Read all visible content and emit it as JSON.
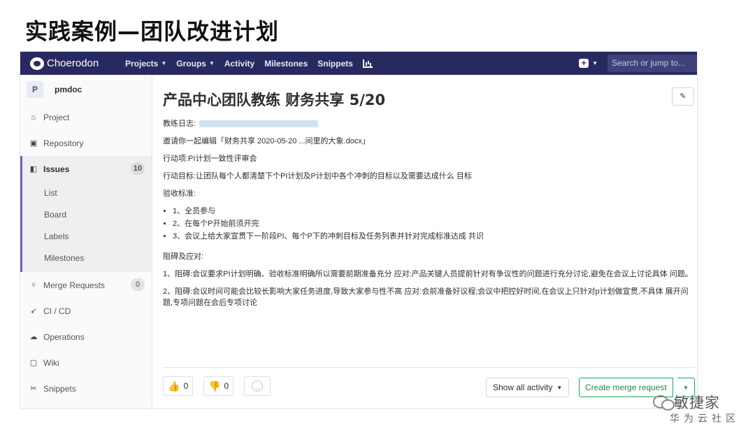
{
  "slide": {
    "title": "实践案例—团队改进计划"
  },
  "navbar": {
    "brand": "Choerodon",
    "items": [
      {
        "label": "Projects",
        "dropdown": true
      },
      {
        "label": "Groups",
        "dropdown": true
      },
      {
        "label": "Activity",
        "dropdown": false
      },
      {
        "label": "Milestones",
        "dropdown": false
      },
      {
        "label": "Snippets",
        "dropdown": false
      }
    ],
    "search_placeholder": "Search or jump to...",
    "plus": "+",
    "background": "#292961"
  },
  "sidebar": {
    "avatar": "P",
    "project_name": "pmdoc",
    "items": [
      {
        "label": "Project",
        "icon": "home-icon"
      },
      {
        "label": "Repository",
        "icon": "file-icon"
      },
      {
        "label": "Issues",
        "icon": "issues-icon",
        "count": "10",
        "active": true
      },
      {
        "label": "Merge Requests",
        "icon": "merge-request-icon",
        "count": "0"
      },
      {
        "label": "CI / CD",
        "icon": "rocket-icon"
      },
      {
        "label": "Operations",
        "icon": "cloud-gear-icon"
      },
      {
        "label": "Wiki",
        "icon": "book-icon"
      },
      {
        "label": "Snippets",
        "icon": "scissors-icon"
      }
    ],
    "issues_sub": [
      "List",
      "Board",
      "Labels",
      "Milestones"
    ]
  },
  "issue": {
    "title": "产品中心团队教练 财务共享 5/20",
    "edit_icon": "✎",
    "coach_log_label": "教练日志:",
    "invite": "邀请你一起编辑「财务共享 2020-05-20 ...间里的大象.docx」",
    "action_item": "行动项:PI计划一致性评审会",
    "goal": "行动目标:让团队每个人都清楚下个PI计划及P计划中各个冲刺的目标以及需要达成什么 目标",
    "acceptance_label": "验收标准:",
    "acceptance": [
      "1、全员参与",
      "2、在每个P开始前须开完",
      "3、会议上给大家宣贯下一阶段PI、每个P下的冲刺目标及任务列表并针对完成标准达成 共识"
    ],
    "obstacles_label": "阻碍及应对:",
    "obstacle_1": "1、阻碍:会议要求PI计划明确、验收标准明确所以需要前期准备充分 应对:产品关键人员提前针对有争议性的问题进行充分讨论,避免在会议上讨论具体 问题。",
    "obstacle_2": "2、阻碍:会议时间可能会比较长影响大家任务进度,导致大家参与性不高 应对:会前准备好议程;会议中把控好时间,在会议上只针对p计划做宣贯,不具体 展开问题,专项问题在会后专项讨论"
  },
  "footer": {
    "thumbs_up_count": "0",
    "thumbs_down_count": "0",
    "activity_label": "Show all activity",
    "merge_label": "Create merge request",
    "merge_color": "#1aaa55"
  },
  "watermark": {
    "name": "敏捷家",
    "sub": "华为云社区"
  }
}
